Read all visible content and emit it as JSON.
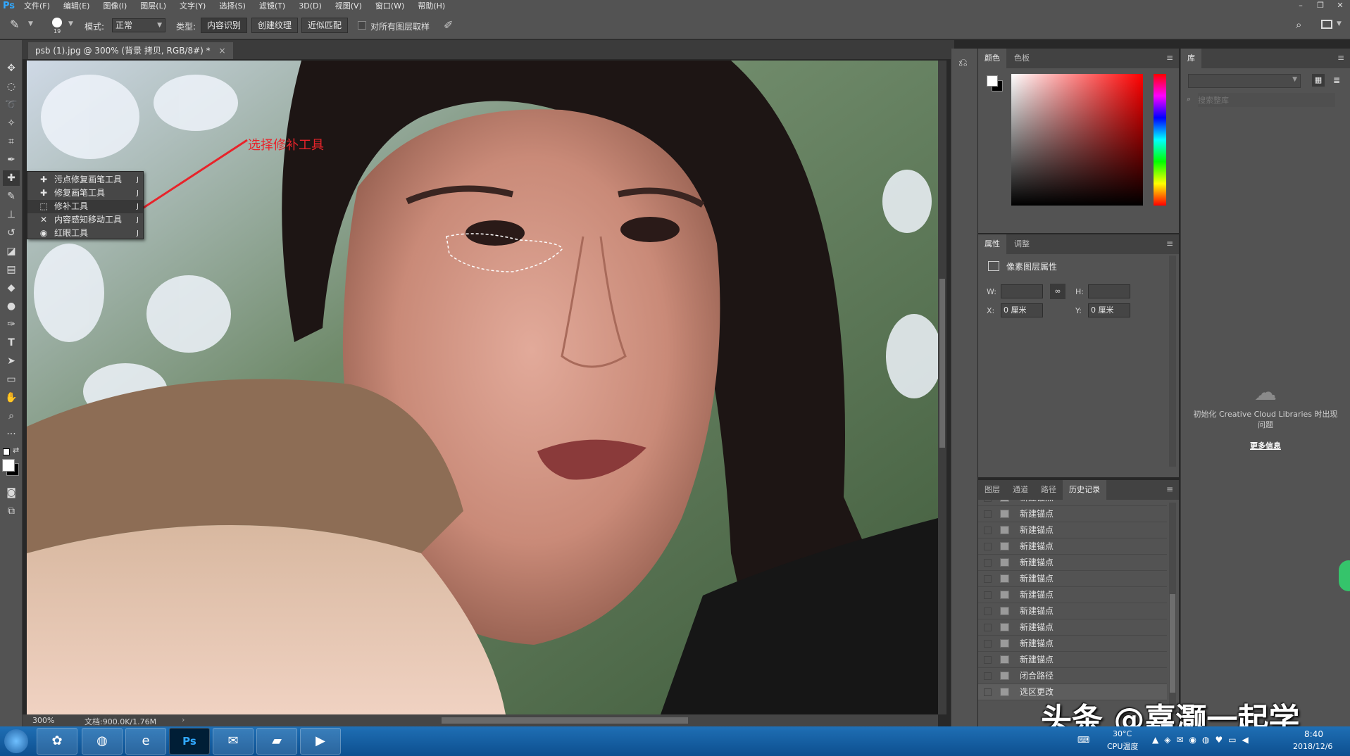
{
  "app": {
    "logo": "Ps"
  },
  "menubar": {
    "items": [
      "文件(F)",
      "编辑(E)",
      "图像(I)",
      "图层(L)",
      "文字(Y)",
      "选择(S)",
      "滤镜(T)",
      "3D(D)",
      "视图(V)",
      "窗口(W)",
      "帮助(H)"
    ]
  },
  "window_controls": {
    "minimize": "–",
    "restore": "❐",
    "close": "✕"
  },
  "options": {
    "brush_size": "19",
    "mode_label": "模式:",
    "mode_value": "正常",
    "type_label": "类型:",
    "type_buttons": [
      "内容识别",
      "创建纹理",
      "近似匹配"
    ],
    "sample_all_label": "对所有图层取样"
  },
  "document": {
    "tab_title": "psb (1).jpg @ 300% (背景 拷贝, RGB/8#) *",
    "close": "×",
    "zoom": "300%",
    "doc_info": "文档:900.0K/1.76M"
  },
  "flyout": {
    "items": [
      {
        "label": "污点修复画笔工具",
        "key": "J",
        "icon": "spot-healing-icon"
      },
      {
        "label": "修复画笔工具",
        "key": "J",
        "icon": "healing-brush-icon"
      },
      {
        "label": "修补工具",
        "key": "J",
        "icon": "patch-icon",
        "selected": true
      },
      {
        "label": "内容感知移动工具",
        "key": "J",
        "icon": "content-aware-move-icon"
      },
      {
        "label": "红眼工具",
        "key": "J",
        "icon": "red-eye-icon"
      }
    ]
  },
  "annotation": {
    "text": "选择修补工具",
    "color": "#e8232a"
  },
  "color_panel": {
    "tabs": [
      "颜色",
      "色板"
    ]
  },
  "properties_panel": {
    "tabs": [
      "属性",
      "调整"
    ],
    "title": "像素图层属性",
    "w_label": "W:",
    "h_label": "H:",
    "x_label": "X:",
    "x_value": "0 厘米",
    "y_label": "Y:",
    "y_value": "0 厘米"
  },
  "history_panel": {
    "tabs": [
      "图层",
      "通道",
      "路径",
      "历史记录"
    ],
    "items": [
      "新建锚点",
      "新建锚点",
      "新建锚点",
      "新建锚点",
      "新建锚点",
      "新建锚点",
      "新建锚点",
      "新建锚点",
      "新建锚点",
      "新建锚点",
      "新建锚点",
      "闭合路径",
      "选区更改"
    ]
  },
  "library_panel": {
    "tab": "库",
    "search_placeholder": "搜索整库",
    "message": "初始化 Creative Cloud Libraries 时出现问题",
    "more_info": "更多信息"
  },
  "taskbar": {
    "temperature": "30°C",
    "cpu_label": "CPU温度",
    "time": "8:40",
    "date": "2018/12/6"
  },
  "watermark": {
    "text": "头条 @嘉灏一起学"
  },
  "colors": {
    "accent": "#31a8ff",
    "annotation": "#e8232a",
    "panel": "#535353"
  }
}
